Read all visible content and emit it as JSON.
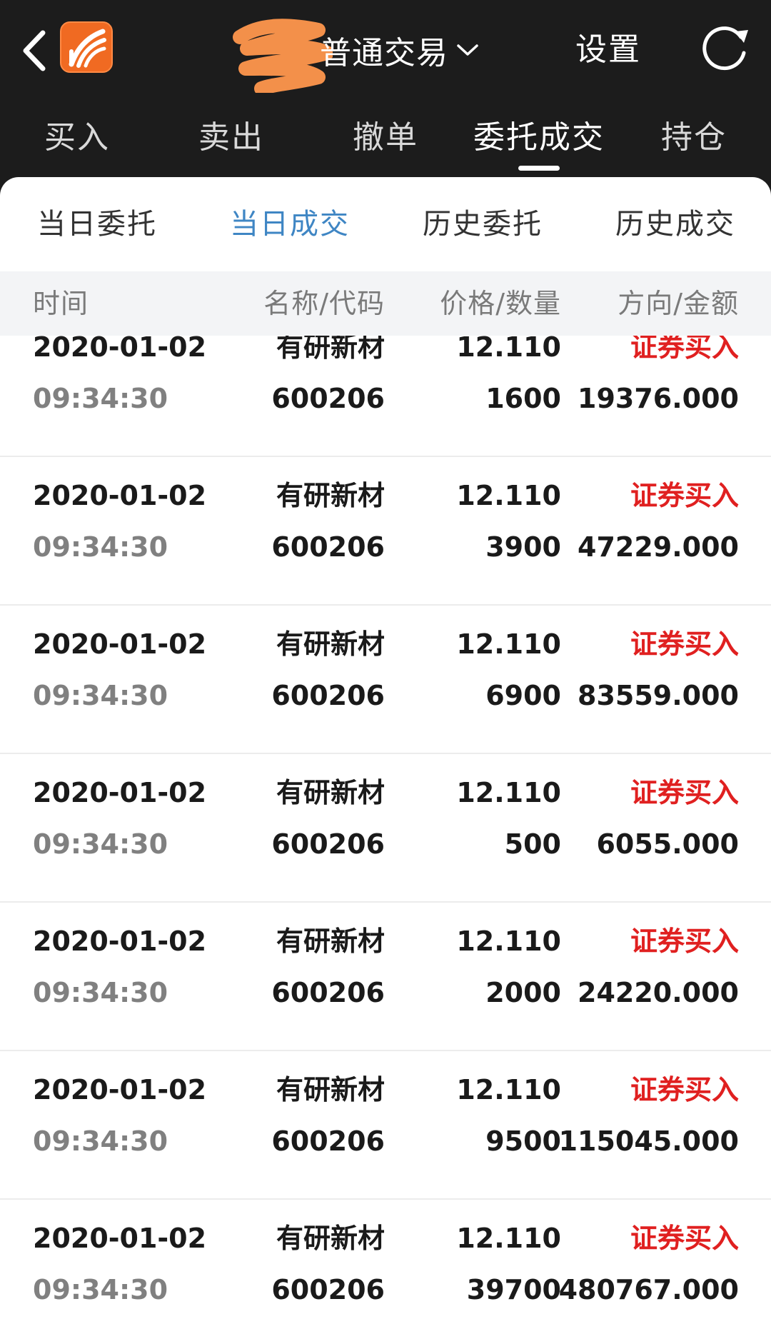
{
  "header": {
    "title": "普通交易",
    "settings_label": "设置"
  },
  "main_tabs": [
    {
      "label": "买入"
    },
    {
      "label": "卖出"
    },
    {
      "label": "撤单"
    },
    {
      "label": "委托成交",
      "active": true
    },
    {
      "label": "持仓"
    }
  ],
  "sub_tabs": [
    {
      "label": "当日委托"
    },
    {
      "label": "当日成交",
      "active": true
    },
    {
      "label": "历史委托"
    },
    {
      "label": "历史成交"
    }
  ],
  "columns": {
    "time": "时间",
    "name_code": "名称/代码",
    "price_qty": "价格/数量",
    "dir_amount": "方向/金额"
  },
  "rows": [
    {
      "date": "2020-01-02",
      "time": "09:34:30",
      "name": "有研新材",
      "code": "600206",
      "price": "12.110",
      "qty": "1600",
      "direction": "证券买入",
      "amount": "19376.000"
    },
    {
      "date": "2020-01-02",
      "time": "09:34:30",
      "name": "有研新材",
      "code": "600206",
      "price": "12.110",
      "qty": "3900",
      "direction": "证券买入",
      "amount": "47229.000"
    },
    {
      "date": "2020-01-02",
      "time": "09:34:30",
      "name": "有研新材",
      "code": "600206",
      "price": "12.110",
      "qty": "6900",
      "direction": "证券买入",
      "amount": "83559.000"
    },
    {
      "date": "2020-01-02",
      "time": "09:34:30",
      "name": "有研新材",
      "code": "600206",
      "price": "12.110",
      "qty": "500",
      "direction": "证券买入",
      "amount": "6055.000"
    },
    {
      "date": "2020-01-02",
      "time": "09:34:30",
      "name": "有研新材",
      "code": "600206",
      "price": "12.110",
      "qty": "2000",
      "direction": "证券买入",
      "amount": "24220.000"
    },
    {
      "date": "2020-01-02",
      "time": "09:34:30",
      "name": "有研新材",
      "code": "600206",
      "price": "12.110",
      "qty": "9500",
      "direction": "证券买入",
      "amount": "115045.000"
    },
    {
      "date": "2020-01-02",
      "time": "09:34:30",
      "name": "有研新材",
      "code": "600206",
      "price": "12.110",
      "qty": "39700",
      "direction": "证券买入",
      "amount": "480767.000"
    }
  ],
  "colors": {
    "background_dark": "#1c1c1c",
    "accent_blue": "#3f86c4",
    "buy_red": "#e02020",
    "logo_orange": "#f06a22"
  },
  "icons": [
    "back-arrow-icon",
    "app-logo-icon",
    "chevron-down-icon",
    "refresh-icon"
  ]
}
